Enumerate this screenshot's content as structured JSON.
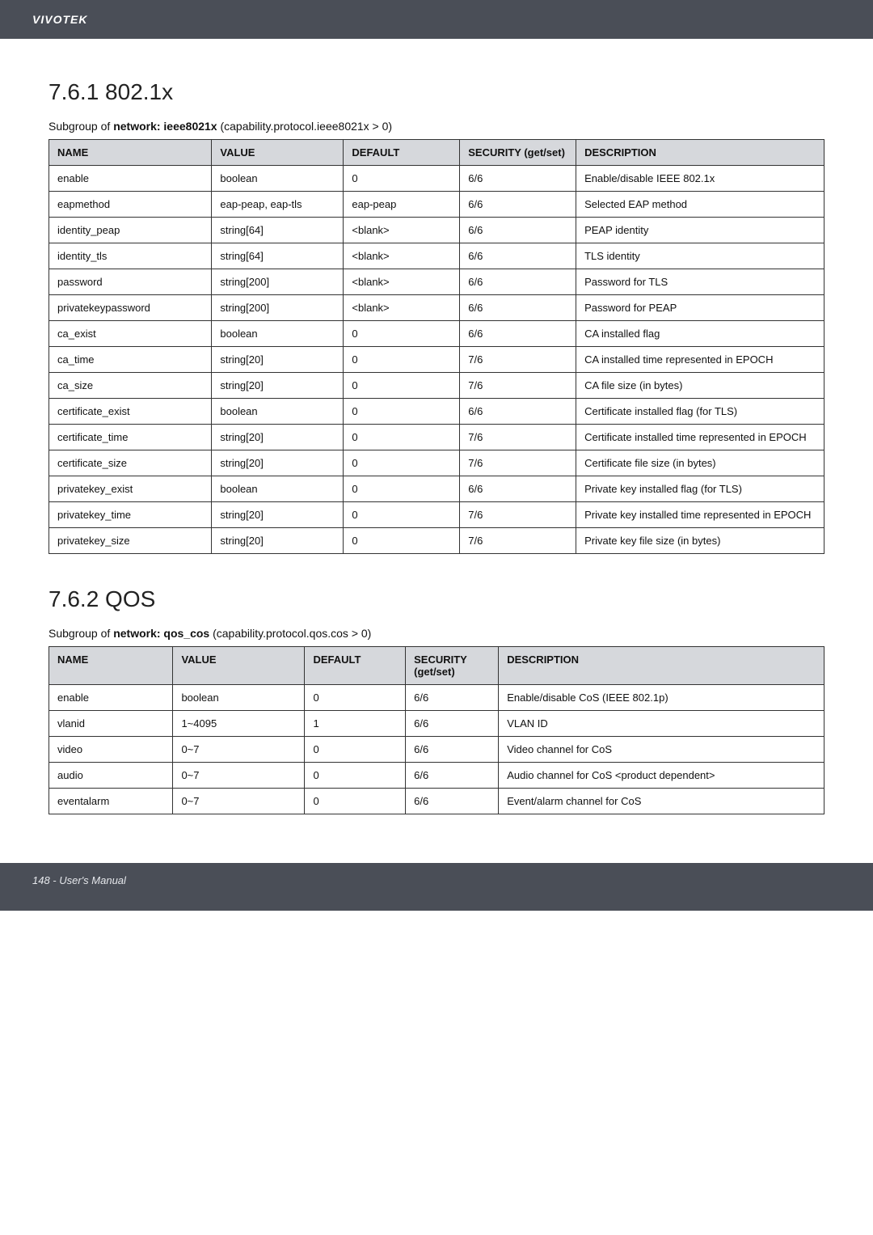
{
  "header": {
    "brand": "VIVOTEK"
  },
  "section1": {
    "heading": "7.6.1 802.1x",
    "subgroup_prefix": "Subgroup of",
    "subgroup_name": "network: ieee8021x",
    "subgroup_suffix": "(capability.protocol.ieee8021x > 0)",
    "columns": {
      "name": "NAME",
      "value": "VALUE",
      "default": "DEFAULT",
      "security": "SECURITY (get/set)",
      "description": "DESCRIPTION"
    },
    "rows": [
      {
        "name": "enable",
        "value": "boolean",
        "default": "0",
        "security": "6/6",
        "desc": "Enable/disable IEEE 802.1x"
      },
      {
        "name": "eapmethod",
        "value": "eap-peap, eap-tls",
        "default": "eap-peap",
        "security": "6/6",
        "desc": "Selected EAP method"
      },
      {
        "name": "identity_peap",
        "value": "string[64]",
        "default": "<blank>",
        "security": "6/6",
        "desc": "PEAP identity"
      },
      {
        "name": "identity_tls",
        "value": "string[64]",
        "default": "<blank>",
        "security": "6/6",
        "desc": "TLS identity"
      },
      {
        "name": "password",
        "value": "string[200]",
        "default": "<blank>",
        "security": "6/6",
        "desc": "Password for TLS"
      },
      {
        "name": "privatekeypassword",
        "value": "string[200]",
        "default": "<blank>",
        "security": "6/6",
        "desc": "Password for PEAP"
      },
      {
        "name": "ca_exist",
        "value": "boolean",
        "default": "0",
        "security": "6/6",
        "desc": "CA installed flag"
      },
      {
        "name": "ca_time",
        "value": "string[20]",
        "default": "0",
        "security": "7/6",
        "desc": "CA installed time represented in EPOCH"
      },
      {
        "name": "ca_size",
        "value": "string[20]",
        "default": "0",
        "security": "7/6",
        "desc": "CA file size (in bytes)"
      },
      {
        "name": "certificate_exist",
        "value": "boolean",
        "default": "0",
        "security": "6/6",
        "desc": "Certificate installed flag (for TLS)"
      },
      {
        "name": "certificate_time",
        "value": "string[20]",
        "default": "0",
        "security": "7/6",
        "desc": "Certificate installed time represented in EPOCH"
      },
      {
        "name": "certificate_size",
        "value": "string[20]",
        "default": "0",
        "security": "7/6",
        "desc": "Certificate file size (in bytes)"
      },
      {
        "name": "privatekey_exist",
        "value": "boolean",
        "default": "0",
        "security": "6/6",
        "desc": "Private key installed flag (for TLS)"
      },
      {
        "name": "privatekey_time",
        "value": "string[20]",
        "default": "0",
        "security": "7/6",
        "desc": "Private key installed time represented in EPOCH"
      },
      {
        "name": "privatekey_size",
        "value": "string[20]",
        "default": "0",
        "security": "7/6",
        "desc": "Private key file size (in bytes)"
      }
    ]
  },
  "section2": {
    "heading": "7.6.2 QOS",
    "subgroup_prefix": "Subgroup of",
    "subgroup_name": "network: qos_cos",
    "subgroup_suffix": "(capability.protocol.qos.cos > 0)",
    "columns": {
      "name": "NAME",
      "value": "VALUE",
      "default": "DEFAULT",
      "security": "SECURITY (get/set)",
      "description": "DESCRIPTION"
    },
    "rows": [
      {
        "name": "enable",
        "value": "boolean",
        "default": "0",
        "security": "6/6",
        "desc": "Enable/disable CoS (IEEE 802.1p)"
      },
      {
        "name": "vlanid",
        "value": "1~4095",
        "default": "1",
        "security": "6/6",
        "desc": "VLAN ID"
      },
      {
        "name": "video",
        "value": "0~7",
        "default": "0",
        "security": "6/6",
        "desc": "Video channel for CoS"
      },
      {
        "name": "audio",
        "value": "0~7",
        "default": "0",
        "security": "6/6",
        "desc": "Audio channel for CoS <product dependent>"
      },
      {
        "name": "eventalarm",
        "value": "0~7",
        "default": "0",
        "security": "6/6",
        "desc": "Event/alarm channel for CoS"
      }
    ]
  },
  "footer": {
    "text": "148 - User's Manual"
  }
}
